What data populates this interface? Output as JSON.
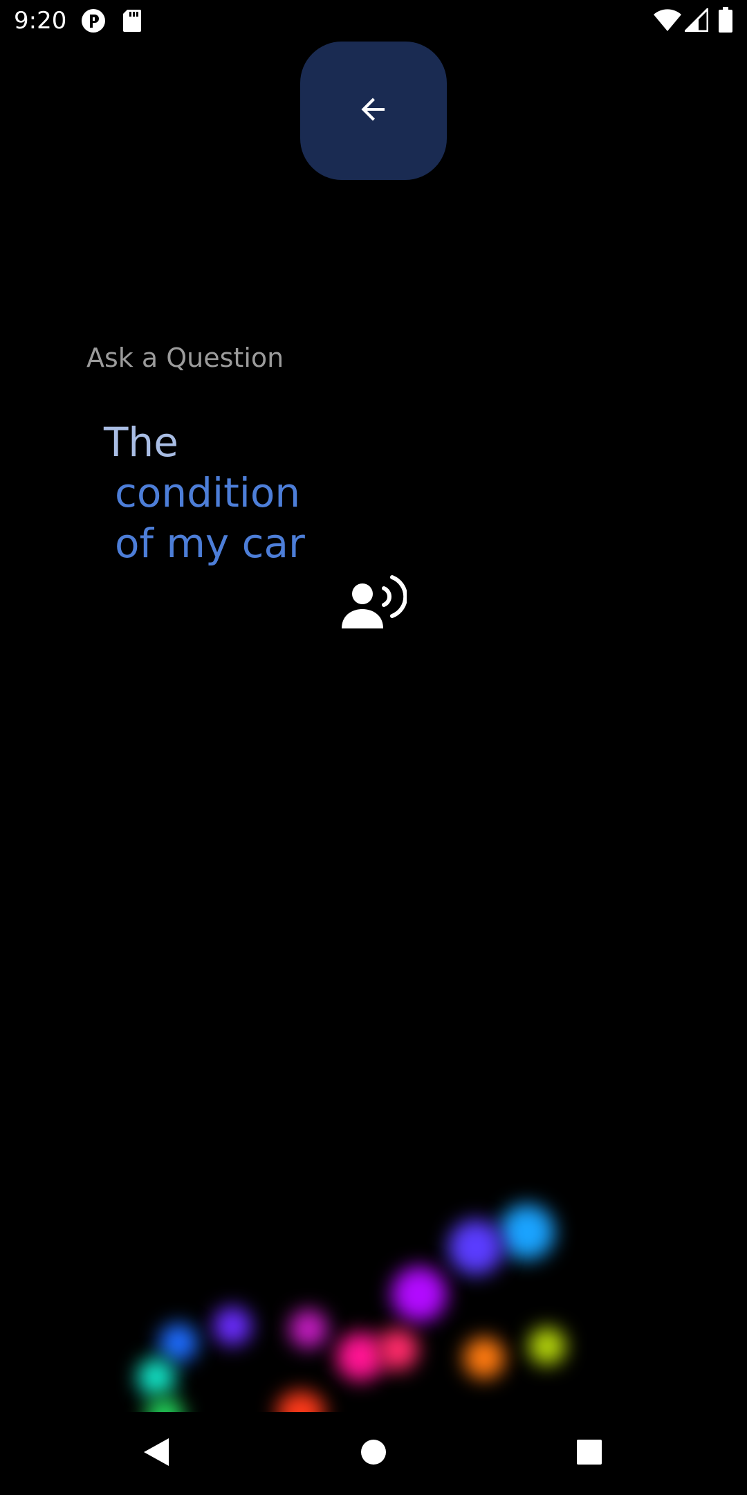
{
  "status_bar": {
    "time": "9:20",
    "left_icons": [
      "podcast-app-icon",
      "sd-card-icon"
    ],
    "right_icons": [
      "wifi-icon",
      "cell-signal-icon",
      "battery-icon"
    ]
  },
  "back_button": {
    "icon": "arrow-left-icon",
    "color": "#1a2b52"
  },
  "prompt": {
    "label": "Ask a Question",
    "lines": [
      "The",
      "condition",
      "of my car"
    ]
  },
  "voice_icon": "voice-speaking-icon",
  "nav_bar": {
    "icons": [
      "back-triangle-icon",
      "home-circle-icon",
      "recents-square-icon"
    ]
  }
}
